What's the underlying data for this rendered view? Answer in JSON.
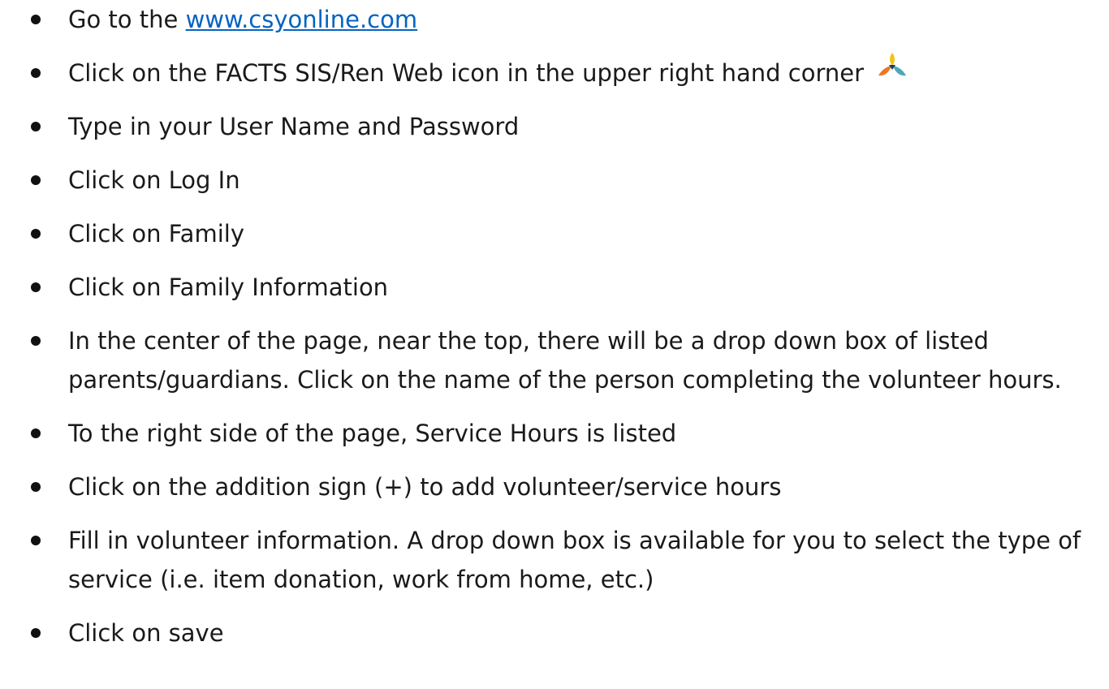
{
  "steps": [
    {
      "prefix": "Go to the ",
      "link": "www.csyonline.com"
    },
    {
      "text": "Click on the FACTS SIS/Ren Web icon in the upper right hand corner",
      "icon": "facts-logo-icon"
    },
    {
      "text": "Type in your User Name and Password"
    },
    {
      "text": "Click on Log In"
    },
    {
      "text": "Click on Family"
    },
    {
      "text": "Click on Family Information"
    },
    {
      "text": "In the center of the page, near the top, there will be a drop down box of listed parents/guardians. Click on the name of the person completing the volunteer hours."
    },
    {
      "text": "To the right side of the page, Service Hours is listed"
    },
    {
      "text": "Click on the addition sign (+) to add volunteer/service hours"
    },
    {
      "text": "Fill in volunteer information. A drop down box is available for you to select the type of service (i.e. item donation, work from home, etc.)"
    },
    {
      "text": "Click on save"
    }
  ],
  "colors": {
    "link": "#0563c1",
    "logo_yellow": "#f2c318",
    "logo_orange": "#e9782a",
    "logo_teal": "#4aa8b8",
    "logo_navy": "#1f3a5f"
  }
}
